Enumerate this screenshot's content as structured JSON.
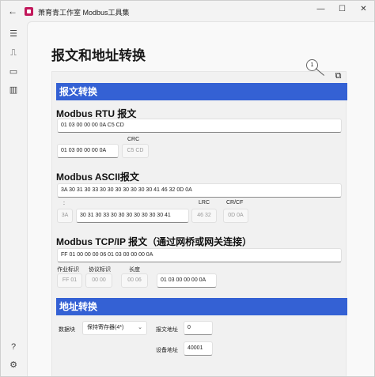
{
  "window": {
    "title": "萧育青工作室 Modbus工具集",
    "back_icon": "back-arrow-icon",
    "controls": [
      "minimize-icon",
      "maximize-icon",
      "close-icon"
    ]
  },
  "sidebar": {
    "items": [
      "menu-icon",
      "usb-icon",
      "card-icon",
      "chart-icon"
    ],
    "bottom": [
      "help-icon",
      "settings-icon"
    ]
  },
  "page": {
    "title": "报文和地址转换",
    "badge": "1"
  },
  "message": {
    "section_title": "报文转换",
    "rtu": {
      "title": "Modbus RTU 报文",
      "full": "01 03 00 00 00 0A C5 CD",
      "data": "01 03 00 00 00 0A",
      "crc_label": "CRC",
      "crc": "C5 CD"
    },
    "ascii": {
      "title": "Modbus ASCII报文",
      "full": "3A 30 31 30 33 30 30 30 30 30 30 30 41 46 32 0D 0A",
      "colon_label": ":",
      "colon": "3A",
      "data": "30 31 30 33 30 30 30 30 30 30 30 41",
      "lrc_label": "LRC",
      "lrc": "46 32",
      "crcf_label": "CR/CF",
      "crcf": "0D 0A"
    },
    "tcp": {
      "title": "Modbus TCP/IP 报文（通过网桥或网关连接）",
      "full": "FF 01 00 00 00 06 01 03 00 00 00 0A",
      "trans_label": "作业标识",
      "trans": "FF 01",
      "proto_label": "协议标识",
      "proto": "00 00",
      "len_label": "长度",
      "len": "00 06",
      "pdu": "01 03 00 00 00 0A"
    }
  },
  "address": {
    "section_title": "地址转换",
    "block_label": "数据块",
    "block_value": "保持寄存器(4*)",
    "msg_addr_label": "报文地址",
    "msg_addr": "0",
    "dev_addr_label": "设备地址",
    "dev_addr": "40001"
  }
}
